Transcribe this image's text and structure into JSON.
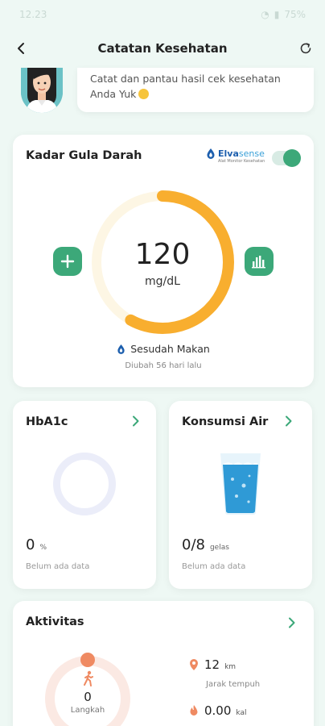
{
  "status_bar": {
    "time": "12.23",
    "battery": "75%"
  },
  "header": {
    "title": "Catatan Kesehatan"
  },
  "greeting": {
    "message": "Catat dan pantau hasil cek kesehatan Anda Yuk"
  },
  "blood_sugar": {
    "title": "Kadar Gula Darah",
    "brand_name": "Elva",
    "brand_name_suffix": "sense",
    "brand_tagline": "Alat Monitor Kesehatan",
    "toggle_on": true,
    "value": "120",
    "unit": "mg/dL",
    "gauge_fill": 0.58,
    "meal_status": "Sesudah Makan",
    "updated": "Diubah 56 hari lalu"
  },
  "hba1c": {
    "title": "HbA1c",
    "value": "0",
    "unit": "%",
    "note": "Belum ada data"
  },
  "water": {
    "title": "Konsumsi Air",
    "value": "0/8",
    "unit": "gelas",
    "note": "Belum ada data"
  },
  "activity": {
    "title": "Aktivitas",
    "steps": "0",
    "steps_label": "Langkah",
    "distance_value": "12",
    "distance_unit": "km",
    "distance_label": "Jarak tempuh",
    "calories_value": "0.00",
    "calories_unit": "kal"
  },
  "colors": {
    "accent": "#3ca879",
    "gauge": "#f8ae2f",
    "activity": "#ef8a62",
    "water": "#2f9ad6"
  }
}
